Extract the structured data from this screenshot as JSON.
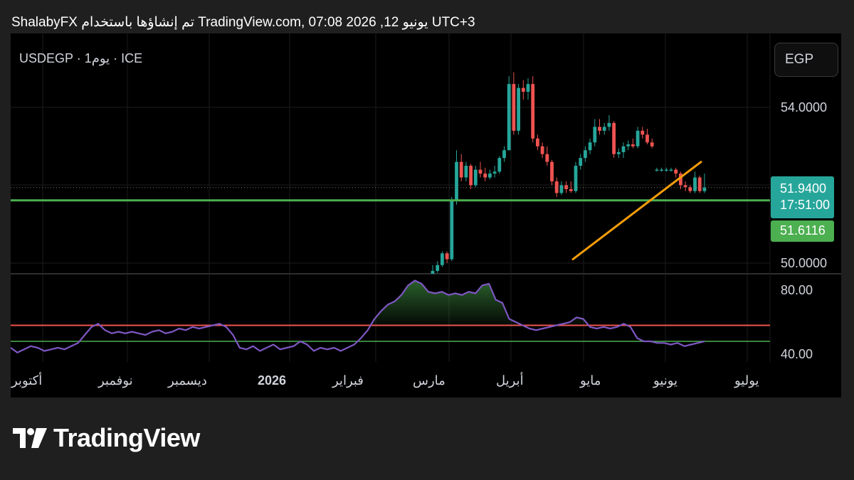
{
  "header": {
    "text": "ShalabyFX تم إنشاؤها باستخدام TradingView.com, 07:08 2026 ,12 يونيو UTC+3"
  },
  "symbol": {
    "label": "USDEGP · 1يوم · ICE"
  },
  "currency_button": {
    "label": "EGP"
  },
  "price_axis": {
    "labels": [
      "54.0000",
      "50.0000"
    ]
  },
  "last_price": {
    "value": "51.9400",
    "countdown": "17:51:00"
  },
  "horizontal_line": {
    "value": "51.6116"
  },
  "rsi_axis": {
    "labels": [
      "80.00",
      "40.00"
    ]
  },
  "time_axis": {
    "labels": [
      "أكتوبر",
      "نوفمبر",
      "ديسمبر",
      "2026",
      "فبراير",
      "مارس",
      "أبريل",
      "مايو",
      "يونيو",
      "يوليو"
    ]
  },
  "brand": {
    "name": "TradingView"
  },
  "colors": {
    "up": "#26a69a",
    "down": "#ef5350",
    "line": "#4caf50",
    "trend": "#f59e0b",
    "rsi": "#7e57c2",
    "rsi_upper": "#ef5350",
    "rsi_lower": "#4caf50"
  },
  "chart_data": [
    {
      "type": "candlestick",
      "title": "USDEGP · 1يوم · ICE",
      "ylim": [
        49.6,
        55.2
      ],
      "last_price": 51.94,
      "horizontal_level": 51.6116,
      "trend_line": [
        [
          50.1,
          52.6
        ]
      ],
      "candles": [
        [
          49.6,
          49.95,
          49.55,
          49.8
        ],
        [
          49.8,
          50.05,
          49.75,
          49.95
        ],
        [
          49.95,
          50.3,
          49.9,
          50.25
        ],
        [
          50.25,
          50.3,
          50.0,
          50.1
        ],
        [
          50.1,
          51.7,
          50.05,
          51.6
        ],
        [
          51.6,
          52.9,
          51.5,
          52.6
        ],
        [
          52.6,
          52.8,
          52.1,
          52.2
        ],
        [
          52.2,
          52.6,
          52.1,
          52.5
        ],
        [
          52.5,
          52.55,
          51.9,
          52.0
        ],
        [
          52.0,
          52.5,
          51.95,
          52.4
        ],
        [
          52.4,
          52.6,
          52.2,
          52.3
        ],
        [
          52.3,
          52.45,
          52.1,
          52.2
        ],
        [
          52.2,
          52.4,
          52.15,
          52.3
        ],
        [
          52.3,
          52.5,
          52.2,
          52.35
        ],
        [
          52.35,
          52.75,
          52.3,
          52.7
        ],
        [
          52.7,
          53.0,
          52.6,
          52.9
        ],
        [
          52.9,
          54.8,
          52.9,
          54.6
        ],
        [
          54.6,
          54.9,
          53.3,
          53.4
        ],
        [
          53.4,
          54.6,
          53.3,
          54.5
        ],
        [
          54.5,
          54.7,
          54.2,
          54.4
        ],
        [
          54.4,
          54.75,
          54.2,
          54.6
        ],
        [
          54.6,
          54.8,
          53.1,
          53.2
        ],
        [
          53.2,
          53.3,
          52.9,
          53.0
        ],
        [
          53.0,
          53.1,
          52.7,
          52.8
        ],
        [
          52.8,
          53.0,
          52.5,
          52.6
        ],
        [
          52.6,
          52.65,
          52.0,
          52.1
        ],
        [
          52.1,
          52.2,
          51.7,
          51.8
        ],
        [
          51.8,
          52.1,
          51.75,
          52.0
        ],
        [
          52.0,
          52.1,
          51.8,
          51.9
        ],
        [
          51.9,
          52.1,
          51.8,
          51.85
        ],
        [
          51.85,
          52.6,
          51.8,
          52.5
        ],
        [
          52.5,
          52.8,
          52.4,
          52.7
        ],
        [
          52.7,
          53.0,
          52.6,
          52.9
        ],
        [
          52.9,
          53.2,
          52.8,
          53.1
        ],
        [
          53.1,
          53.7,
          53.0,
          53.5
        ],
        [
          53.5,
          53.7,
          53.3,
          53.4
        ],
        [
          53.4,
          53.6,
          53.3,
          53.5
        ],
        [
          53.5,
          53.8,
          53.4,
          53.6
        ],
        [
          53.6,
          53.65,
          52.7,
          52.8
        ],
        [
          52.8,
          52.95,
          52.7,
          52.85
        ],
        [
          52.85,
          53.1,
          52.7,
          53.0
        ],
        [
          53.0,
          53.15,
          52.9,
          53.05
        ],
        [
          53.05,
          53.2,
          52.95,
          53.0
        ],
        [
          53.0,
          53.5,
          52.95,
          53.4
        ],
        [
          53.4,
          53.5,
          53.2,
          53.3
        ],
        [
          53.3,
          53.45,
          53.05,
          53.1
        ],
        [
          53.1,
          53.2,
          52.95,
          53.0
        ],
        [
          52.4,
          52.45,
          52.35,
          52.4
        ],
        [
          52.4,
          52.45,
          52.35,
          52.4
        ],
        [
          52.4,
          52.45,
          52.35,
          52.4
        ],
        [
          52.4,
          52.45,
          52.35,
          52.4
        ],
        [
          52.4,
          52.45,
          52.2,
          52.3
        ],
        [
          52.3,
          52.35,
          51.9,
          52.0
        ],
        [
          52.0,
          52.1,
          51.85,
          51.95
        ],
        [
          51.95,
          52.0,
          51.8,
          51.85
        ],
        [
          51.85,
          52.35,
          51.8,
          52.2
        ],
        [
          52.2,
          52.25,
          51.8,
          51.85
        ],
        [
          51.85,
          52.3,
          51.8,
          51.94
        ]
      ]
    },
    {
      "type": "line",
      "name": "RSI",
      "ylim": [
        38,
        88
      ],
      "levels": [
        58,
        48
      ],
      "values": [
        44,
        41,
        43,
        45,
        44,
        42,
        43,
        44,
        43,
        45,
        47,
        52,
        57,
        59,
        55,
        53,
        54,
        53,
        54,
        53,
        52,
        54,
        55,
        53,
        54,
        56,
        55,
        57,
        56,
        57,
        58,
        59,
        57,
        52,
        44,
        43,
        45,
        42,
        44,
        46,
        43,
        44,
        45,
        48,
        46,
        42,
        44,
        43,
        44,
        42,
        44,
        46,
        50,
        55,
        62,
        67,
        71,
        73,
        77,
        83,
        86,
        84,
        79,
        78,
        79,
        77,
        78,
        77,
        79,
        78,
        83,
        84,
        74,
        72,
        62,
        60,
        58,
        56,
        55,
        56,
        57,
        58,
        59,
        60,
        63,
        62,
        57,
        56,
        57,
        56,
        57,
        59,
        57,
        50,
        48,
        48,
        47,
        47,
        46,
        47,
        45,
        46,
        47,
        48
      ]
    }
  ]
}
